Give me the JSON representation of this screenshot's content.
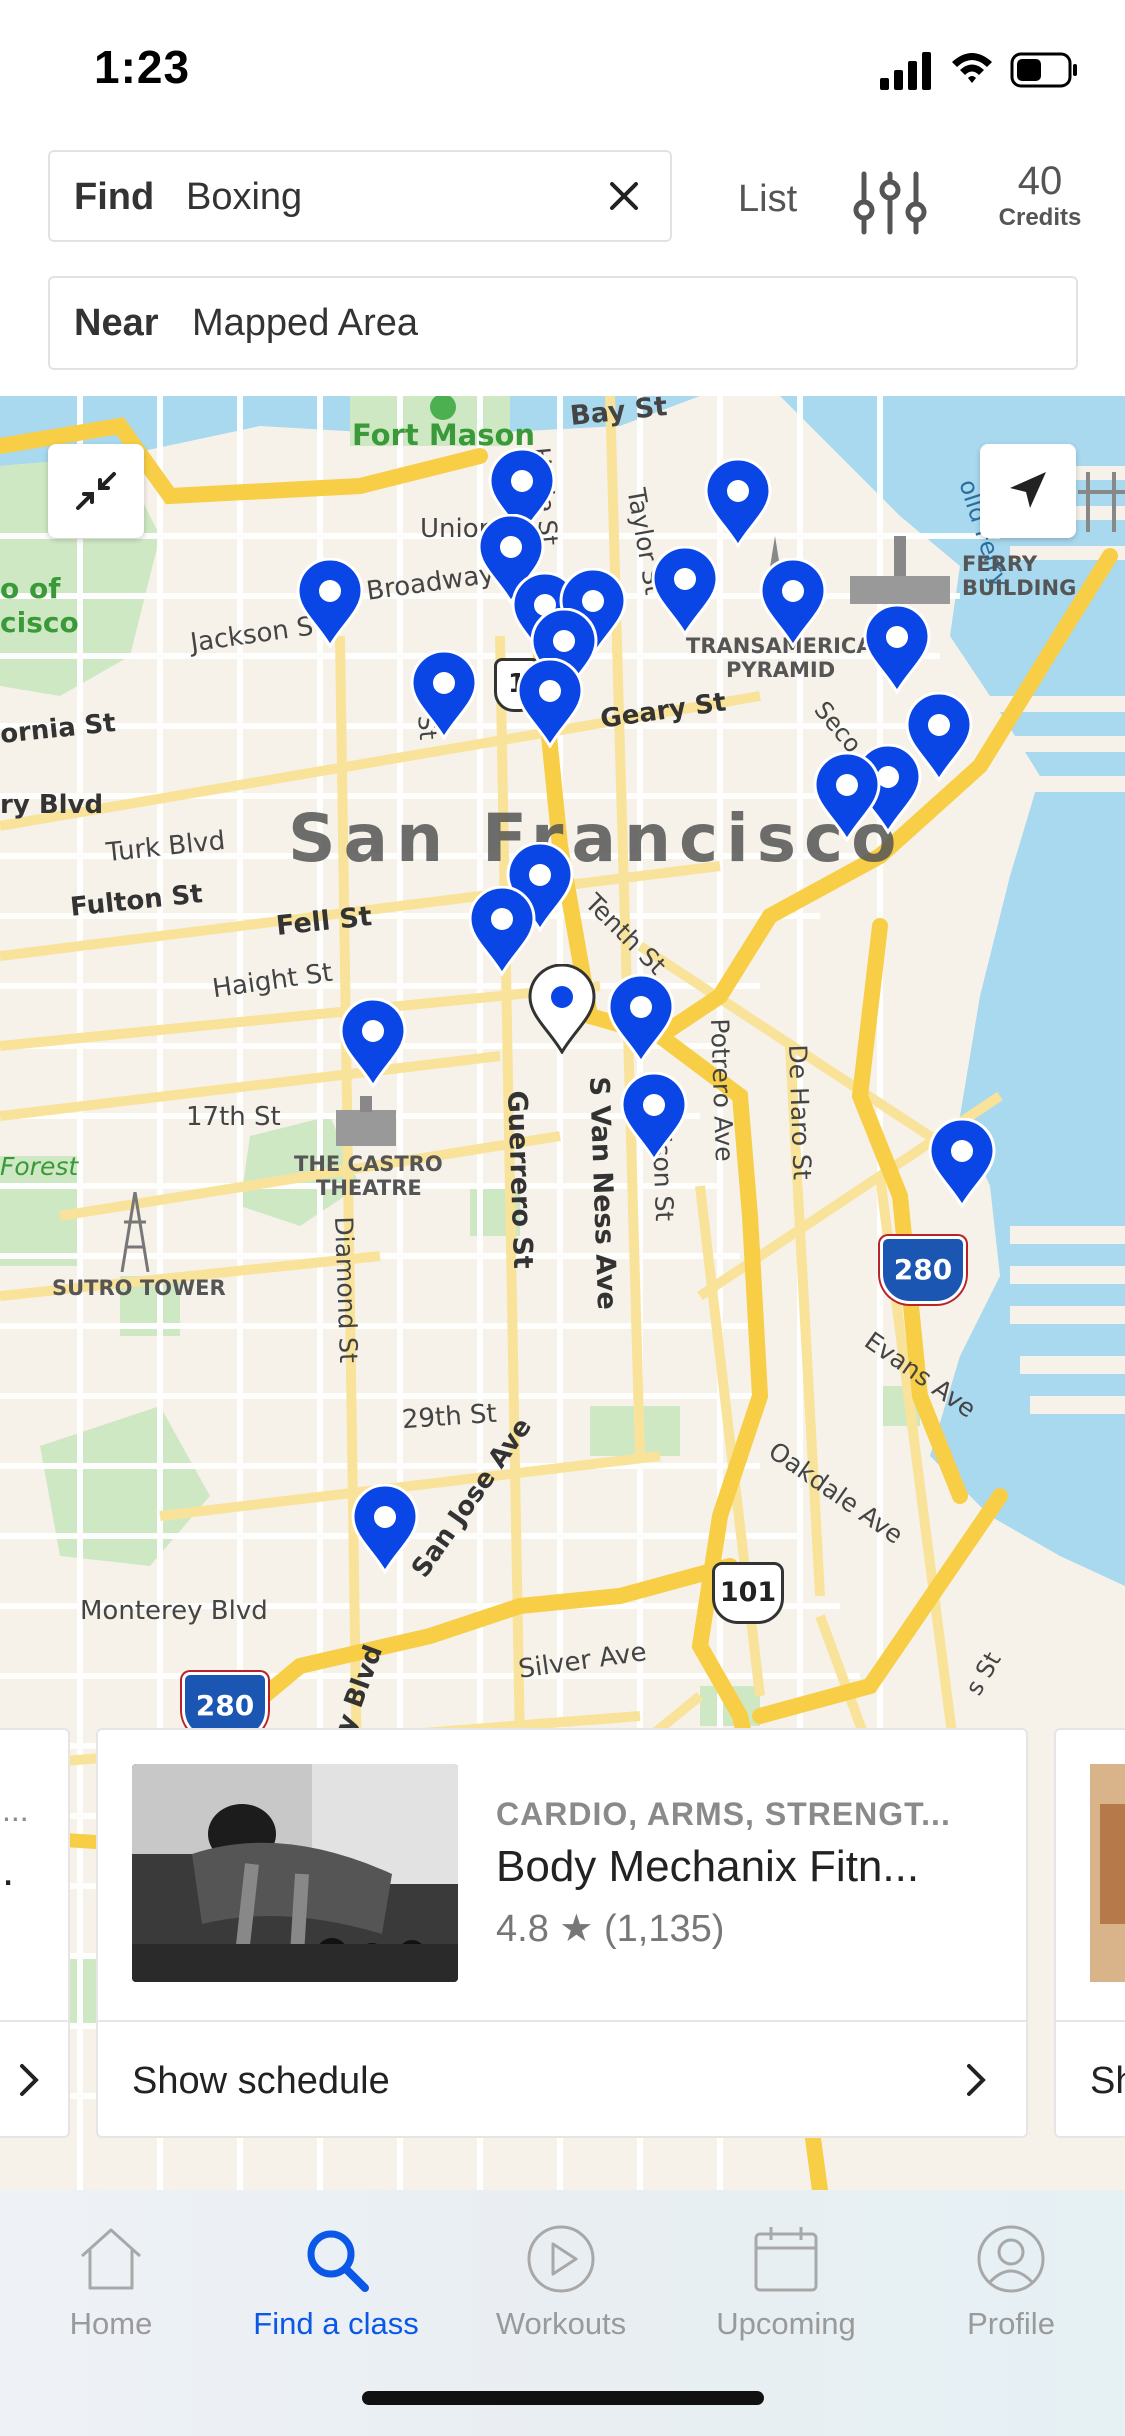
{
  "status_bar": {
    "time": "1:23"
  },
  "search": {
    "find_label": "Find",
    "find_value": "Boxing",
    "list_label": "List",
    "credits_count": "40",
    "credits_label": "Credits",
    "near_label": "Near",
    "near_value": "Mapped Area"
  },
  "map": {
    "labels": {
      "fort_mason": "Fort Mason",
      "bay_st": "Bay St",
      "union": "Union",
      "hyde_st": "Hyde St",
      "taylor_st": "Taylor St",
      "ferry_ferry": "olld Ferry",
      "ferry_building_1": "FERRY",
      "ferry_building_2": "BUILDING",
      "o_of": "o of",
      "cisco": "cisco",
      "broadway": "Broadway",
      "jackson_st": "Jackson S",
      "transamerica_1": "TRANSAMERICA",
      "transamerica_2": "PYRAMID",
      "ornia_st": "ornia St",
      "geary_st": "Geary St",
      "second_st": "Seco",
      "st_partial": "St",
      "ry_blvd": "ry Blvd",
      "turk_blvd": "Turk Blvd",
      "city_name": "San Francisco",
      "fulton_st": "Fulton St",
      "fell_st": "Fell St",
      "tenth_st": "Tenth St",
      "haight_st": "Haight St",
      "potrero_ave": "Potrero Ave",
      "de_haro_st": "De Haro St",
      "seventeenth_st": "17th St",
      "guerrero_st": "Guerrero St",
      "s_van_ness_ave": "S Van Ness Ave",
      "ison_st": "ison St",
      "castro_1": "THE CASTRO",
      "castro_2": "THEATRE",
      "forest": "Forest",
      "sutro_tower": "SUTRO TOWER",
      "diamond_st": "Diamond St",
      "hwy_280_a": "280",
      "evans_ave": "Evans Ave",
      "twentyninth_st": "29th St",
      "oakdale_ave": "Oakdale Ave",
      "san_jose_ave": "San Jose Ave",
      "hwy_101": "101",
      "monterey_blvd": "Monterey Blvd",
      "silver_ave": "Silver Ave",
      "hwy_280_b": "280",
      "y_blvd": "y Blvd",
      "s_st": "s St",
      "hwy_1": "1"
    },
    "pin_count": 24,
    "selected_pin_count": 1,
    "pin_color": "#0a45e6"
  },
  "cards": {
    "left_partial": {
      "rating_partial": "...",
      "subtitle_partial": "."
    },
    "main": {
      "category": "CARDIO, ARMS, STRENGT...",
      "title": "Body Mechanix Fitn...",
      "rating": "4.8 ★ (1,135)",
      "schedule_label": "Show schedule"
    },
    "right_partial": {
      "schedule_label": "Sh"
    }
  },
  "tabs": [
    {
      "label": "Home",
      "active": false
    },
    {
      "label": "Find a class",
      "active": true
    },
    {
      "label": "Workouts",
      "active": false
    },
    {
      "label": "Upcoming",
      "active": false
    },
    {
      "label": "Profile",
      "active": false
    }
  ],
  "colors": {
    "accent": "#0a57e8",
    "water": "#a9d9ef",
    "land": "#f6f2ea",
    "park": "#cfe8c4",
    "highway": "#f7ce45"
  }
}
